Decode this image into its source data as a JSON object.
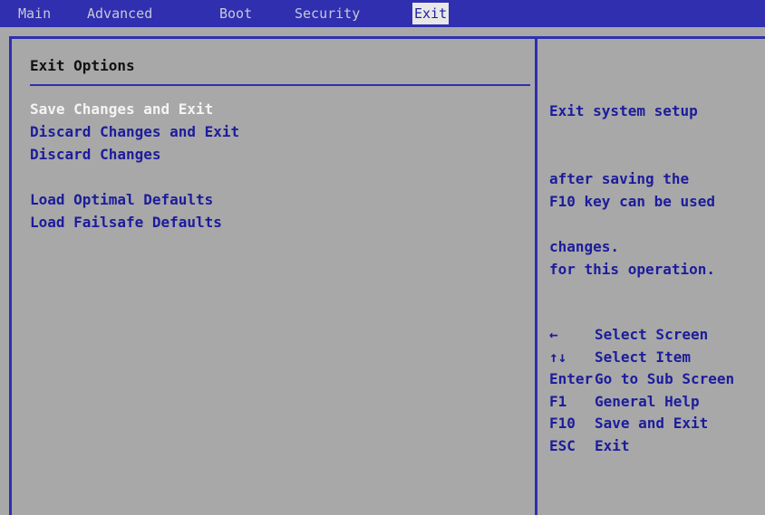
{
  "menubar": {
    "tabs": [
      {
        "label": "Main"
      },
      {
        "label": "Advanced"
      },
      {
        "label": "Boot"
      },
      {
        "label": "Security"
      },
      {
        "label": "Exit"
      }
    ],
    "active_tab": "Exit"
  },
  "left_pane": {
    "title": "Exit Options",
    "options": [
      {
        "label": "Save Changes and Exit",
        "selected": true
      },
      {
        "label": "Discard Changes and Exit",
        "selected": false
      },
      {
        "label": "Discard Changes",
        "selected": false
      },
      {
        "label": "Load Optimal Defaults",
        "selected": false
      },
      {
        "label": "Load Failsafe Defaults",
        "selected": false
      }
    ]
  },
  "help_pane": {
    "description_lines": [
      "Exit system setup",
      "after saving the",
      "changes."
    ],
    "note_lines": [
      "F10 key can be used",
      "for this operation."
    ],
    "keys": [
      {
        "key": "←",
        "action": "Select Screen"
      },
      {
        "key": "↑↓",
        "action": "Select Item"
      },
      {
        "key": "Enter",
        "action": "Go to Sub Screen"
      },
      {
        "key": "F1",
        "action": "General Help"
      },
      {
        "key": "F10",
        "action": "Save and Exit"
      },
      {
        "key": "ESC",
        "action": "Exit"
      }
    ]
  },
  "colors": {
    "background": "#a8a8a8",
    "accent_blue": "#2f2fb0",
    "text_blue": "#1c1c9c",
    "selected_text": "#f4f4f4"
  }
}
